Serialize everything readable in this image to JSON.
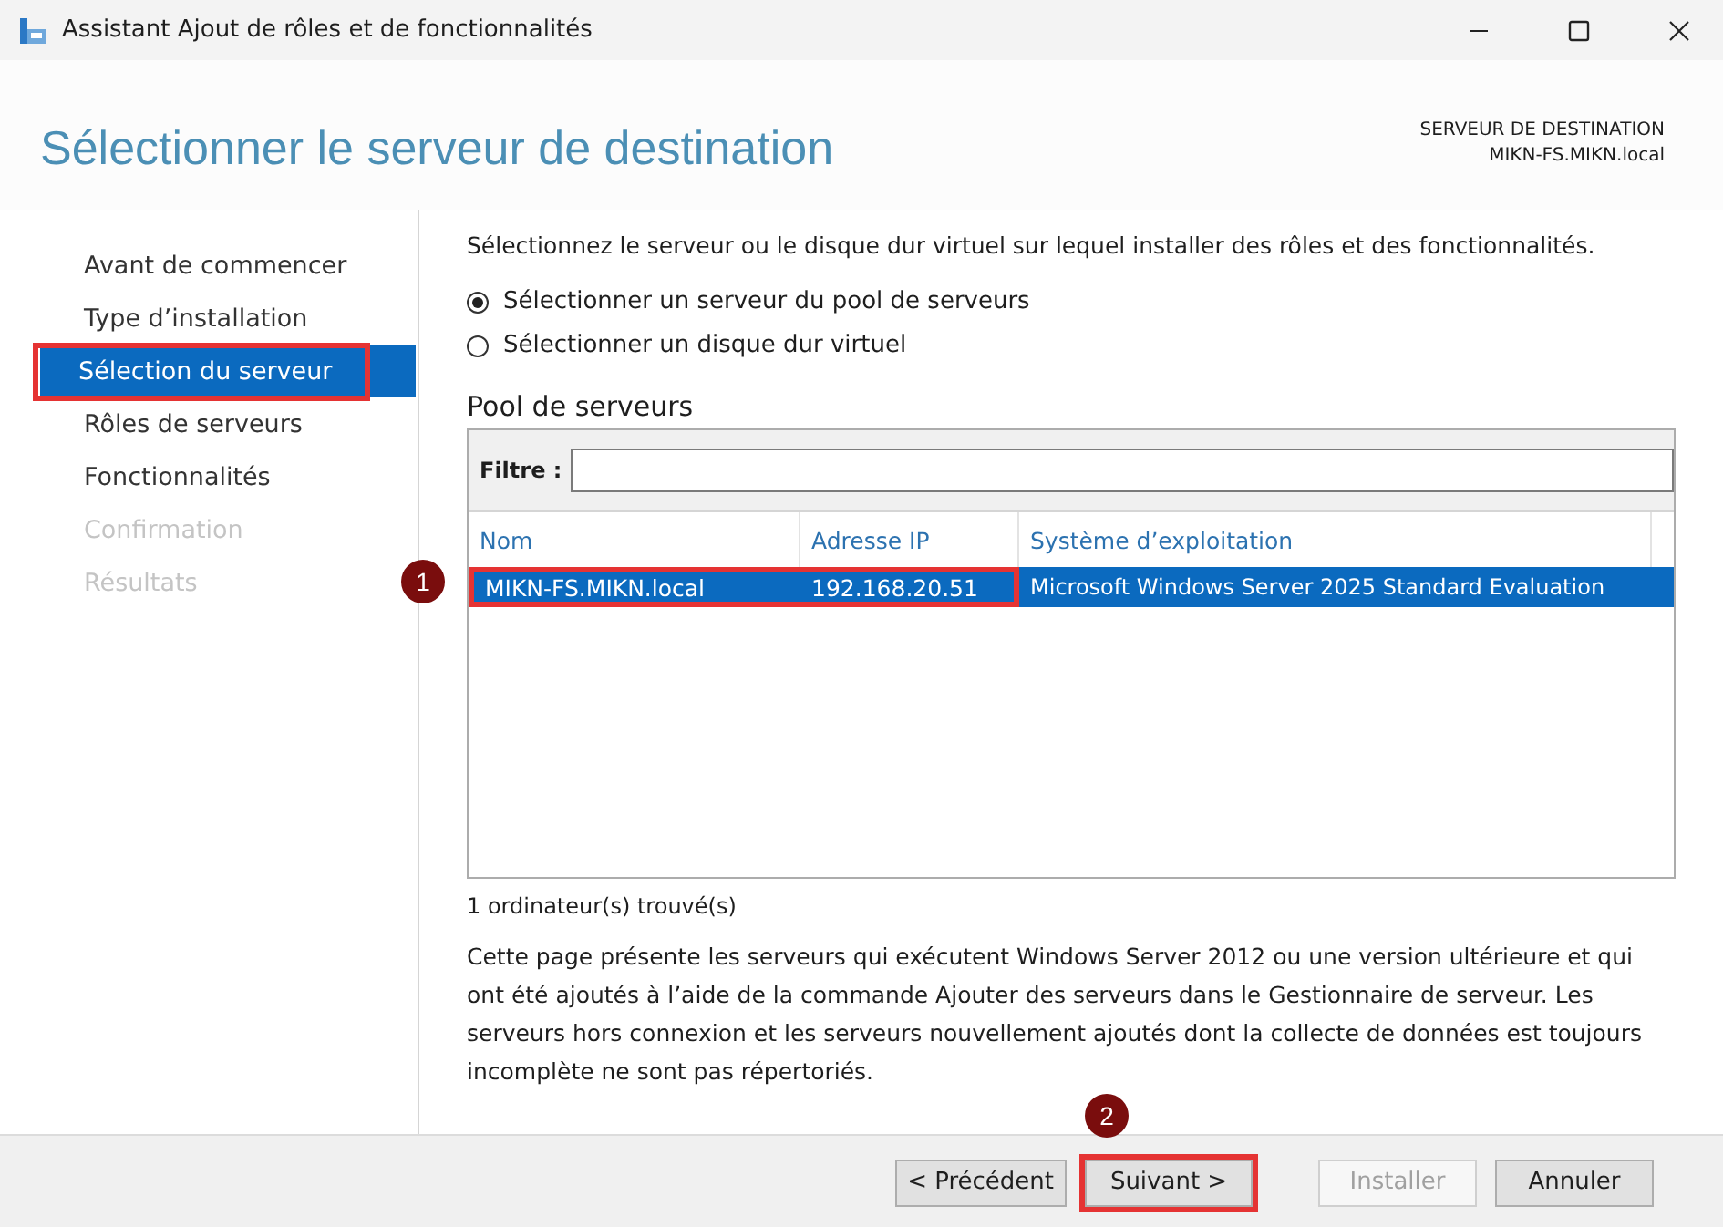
{
  "window": {
    "title": "Assistant Ajout de rôles et de fonctionnalités"
  },
  "header": {
    "title": "Sélectionner le serveur de destination",
    "destination_label": "SERVEUR DE DESTINATION",
    "destination_server": "MIKN-FS.MIKN.local"
  },
  "sidebar": {
    "items": [
      {
        "label": "Avant de commencer",
        "selected": false,
        "disabled": false,
        "highlighted": false
      },
      {
        "label": "Type d’installation",
        "selected": false,
        "disabled": false,
        "highlighted": false
      },
      {
        "label": "Sélection du serveur",
        "selected": true,
        "disabled": false,
        "highlighted": true
      },
      {
        "label": "Rôles de serveurs",
        "selected": false,
        "disabled": false,
        "highlighted": false
      },
      {
        "label": "Fonctionnalités",
        "selected": false,
        "disabled": false,
        "highlighted": false
      },
      {
        "label": "Confirmation",
        "selected": false,
        "disabled": true,
        "highlighted": false
      },
      {
        "label": "Résultats",
        "selected": false,
        "disabled": true,
        "highlighted": false
      }
    ]
  },
  "intro": "Sélectionnez le serveur ou le disque dur virtuel sur lequel installer des rôles et des fonctionnalités.",
  "options": [
    {
      "label": "Sélectionner un serveur du pool de serveurs",
      "selected": true
    },
    {
      "label": "Sélectionner un disque dur virtuel",
      "selected": false
    }
  ],
  "pool": {
    "title": "Pool de serveurs",
    "filter_label": "Filtre :",
    "columns": [
      "Nom",
      "Adresse IP",
      "Système d’exploitation"
    ],
    "rows": [
      {
        "selected": true,
        "callout": "1",
        "cells": [
          {
            "text": "MIKN-FS.MIKN.local",
            "highlighted": true
          },
          {
            "text": "192.168.20.51",
            "highlighted": true
          },
          {
            "text": "Microsoft Windows Server 2025 Standard Evaluation",
            "highlighted": false
          }
        ]
      }
    ],
    "count": "1 ordinateur(s) trouvé(s)"
  },
  "description": "Cette page présente les serveurs qui exécutent Windows Server 2012 ou une version ultérieure et qui ont été ajoutés à l’aide de la commande Ajouter des serveurs dans le Gestionnaire de serveur. Les serveurs hors connexion et les serveurs nouvellement ajoutés dont la collecte de données est toujours incomplète ne sont pas répertoriés.",
  "buttons": [
    {
      "label": "< Précédent",
      "disabled": false,
      "highlighted": false
    },
    {
      "label": "Suivant >",
      "disabled": false,
      "highlighted": true,
      "callout": "2"
    },
    {
      "label": "Installer",
      "disabled": true,
      "highlighted": false
    },
    {
      "label": "Annuler",
      "disabled": false,
      "highlighted": false
    }
  ]
}
